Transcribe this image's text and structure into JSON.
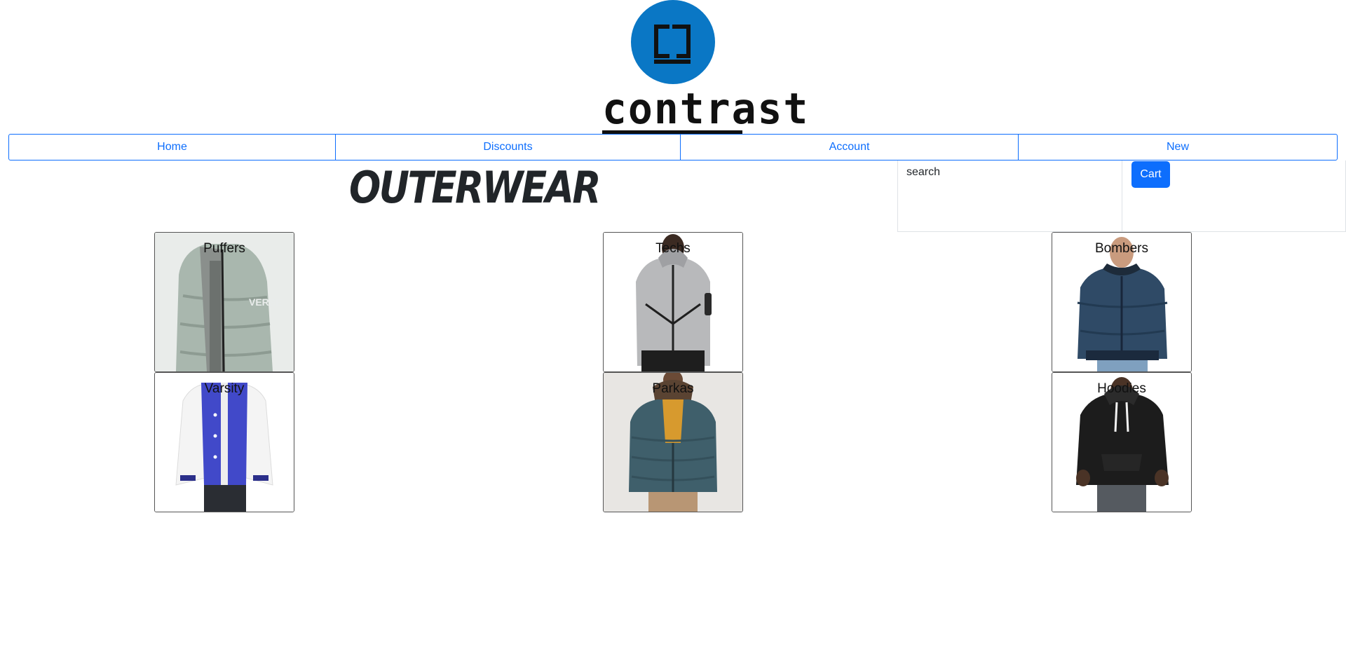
{
  "header": {
    "logo_text": "contrast",
    "logo_icon": "cj-monogram-icon",
    "brand_color": "#0a77c5"
  },
  "nav": {
    "items": [
      {
        "label": "Home"
      },
      {
        "label": "Discounts"
      },
      {
        "label": "Account"
      },
      {
        "label": "New"
      }
    ],
    "link_color": "#0d6efd"
  },
  "main": {
    "title": "OUTERWEAR"
  },
  "search": {
    "placeholder": "search"
  },
  "cart": {
    "label": "Cart",
    "color": "#0d6efd"
  },
  "categories": [
    {
      "label": "Puffers",
      "icon": "puffer-jacket-photo"
    },
    {
      "label": "Techs",
      "icon": "tech-fleece-photo"
    },
    {
      "label": "Bombers",
      "icon": "bomber-jacket-photo"
    },
    {
      "label": "Varsity",
      "icon": "varsity-jacket-photo"
    },
    {
      "label": "Parkas",
      "icon": "parka-jacket-photo"
    },
    {
      "label": "Hoodies",
      "icon": "hoodie-photo"
    }
  ]
}
